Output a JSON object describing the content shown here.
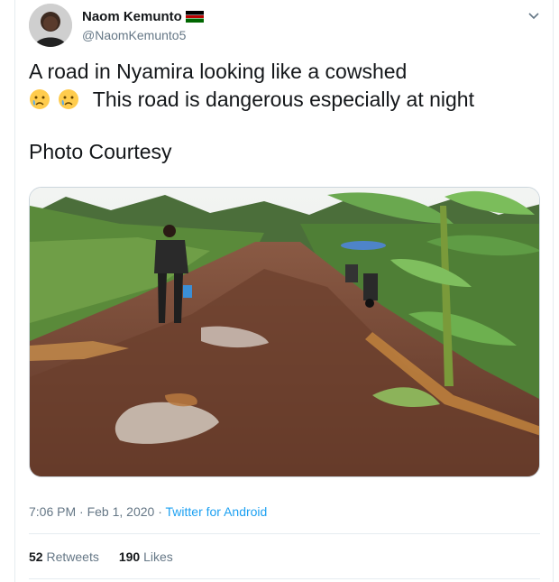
{
  "author": {
    "name": "Naom Kemunto",
    "handle": "@NaomKemunto5"
  },
  "icons": {
    "flag": "kenya-flag-icon",
    "emoji": "crying-face-icon",
    "caret": "chevron-down-icon"
  },
  "tweet": {
    "line1": "A road in Nyamira looking like a cowshed",
    "line2": "This road is dangerous especially at night",
    "line3": "Photo Courtesy"
  },
  "meta": {
    "time": "7:06 PM · Feb 1, 2020 · ",
    "source": "Twitter for Android"
  },
  "stats": {
    "retweets_count": "52",
    "retweets_label": "Retweets",
    "likes_count": "190",
    "likes_label": "Likes"
  }
}
